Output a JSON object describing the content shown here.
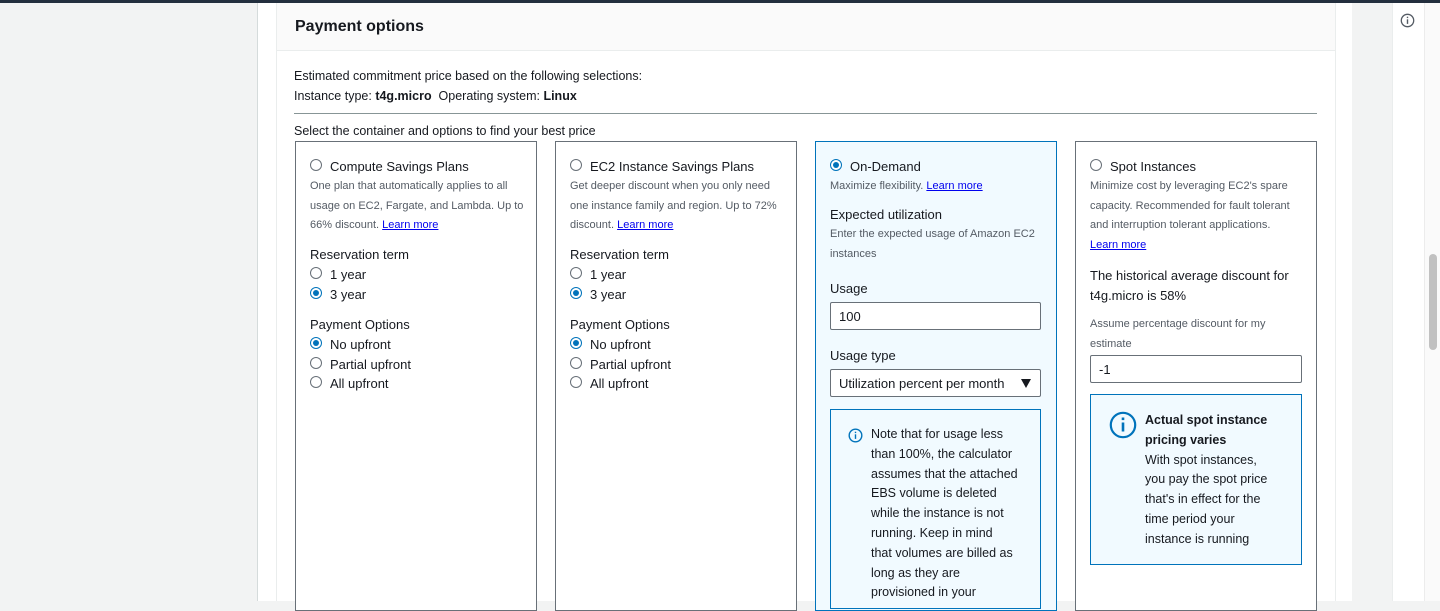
{
  "page": {
    "panel_title": "Payment options",
    "estimate_line": "Estimated commitment price based on the following selections:",
    "instance_type_label": "Instance type:",
    "instance_type_value": "t4g.micro",
    "os_label": "Operating system:",
    "os_value": "Linux",
    "select_prompt": "Select the container and options to find your best price"
  },
  "compute_sp": {
    "title": "Compute Savings Plans",
    "desc_lines": [
      "One plan that automatically applies to all",
      "usage on EC2, Fargate, and Lambda. Up to",
      "66% discount."
    ],
    "learn_more": "Learn more",
    "term_label": "Reservation term",
    "term_1": "1 year",
    "term_3": "3 year",
    "payment_label": "Payment Options",
    "pay_none": "No upfront",
    "pay_partial": "Partial upfront",
    "pay_all": "All upfront"
  },
  "ec2_sp": {
    "title": "EC2 Instance Savings Plans",
    "desc_lines": [
      "Get deeper discount when you only need",
      "one instance family and region. Up to 72%",
      "discount."
    ],
    "learn_more": "Learn more",
    "term_label": "Reservation term",
    "term_1": "1 year",
    "term_3": "3 year",
    "payment_label": "Payment Options",
    "pay_none": "No upfront",
    "pay_partial": "Partial upfront",
    "pay_all": "All upfront"
  },
  "on_demand": {
    "title": "On-Demand",
    "desc": "Maximize flexibility.",
    "learn_more": "Learn more",
    "expected_label": "Expected utilization",
    "expected_desc_lines": [
      "Enter the expected usage of Amazon EC2",
      "instances"
    ],
    "usage_label": "Usage",
    "usage_value": "100",
    "usage_type_label": "Usage type",
    "usage_type_value": "Utilization percent per month",
    "note_lines": [
      "Note that for usage less",
      "than 100%, the calculator",
      "assumes that the attached",
      "EBS volume is deleted",
      "while the instance is not",
      "running. Keep in mind",
      "that volumes are billed as",
      "long as they are",
      "provisioned in your"
    ]
  },
  "spot": {
    "title": "Spot Instances",
    "desc_lines": [
      "Minimize cost by leveraging EC2's spare",
      "capacity. Recommended for fault tolerant",
      "and interruption tolerant applications."
    ],
    "learn_more": "Learn more",
    "hist_lines": [
      "The historical average discount for",
      "t4g.micro is 58%"
    ],
    "assume_lines": [
      "Assume percentage discount for my",
      "estimate"
    ],
    "discount_value": "-1",
    "alert_title_lines": [
      "Actual spot instance",
      "pricing varies"
    ],
    "alert_body_lines": [
      "With spot instances,",
      "you pay the spot price",
      "that's in effect for the",
      "time period your",
      "instance is running"
    ]
  },
  "selection": {
    "plan": "On-Demand",
    "compute_term": "3 year",
    "compute_payment": "No upfront",
    "ec2_term": "3 year",
    "ec2_payment": "No upfront"
  },
  "colors": {
    "accent": "#0073bb",
    "link": "#0000ee",
    "border": "#687078",
    "selected_bg": "#f1faff"
  },
  "icons": {
    "rail": "info-icon",
    "note": "info-icon",
    "alert": "info-icon"
  }
}
